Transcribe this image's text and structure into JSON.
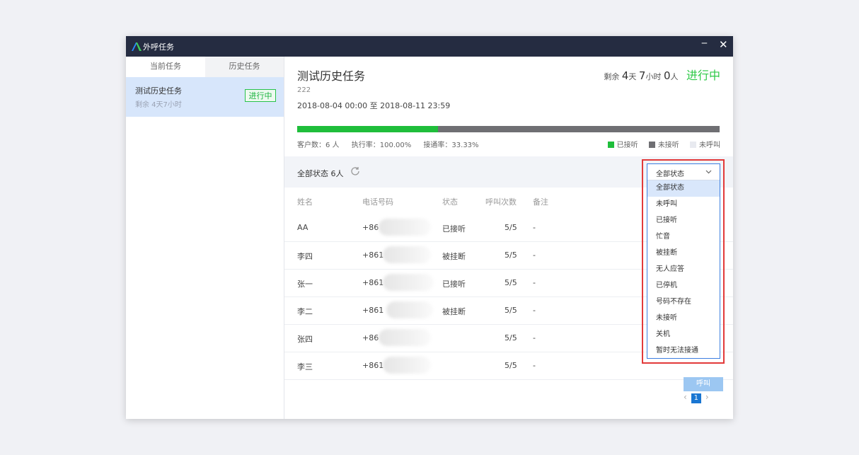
{
  "window": {
    "title": "外呼任务",
    "minimize": "‒",
    "close": "✕"
  },
  "sidebar": {
    "tabs": [
      {
        "label": "当前任务"
      },
      {
        "label": "历史任务"
      }
    ],
    "task": {
      "name": "测试历史任务",
      "remain": "剩余 4天7小时",
      "badge": "进行中"
    }
  },
  "main": {
    "title": "测试历史任务",
    "code": "222",
    "range": "2018-08-04 00:00 至 2018-08-11 23:59",
    "remain": {
      "prefix": "剩余",
      "days": "4",
      "days_unit": "天",
      "hours": "7",
      "hours_unit": "小时",
      "people": "0",
      "people_unit": "人",
      "status": "进行中"
    },
    "progress": {
      "answered_fraction": 0.333,
      "color_answered": "#1fbe3b",
      "color_unanswered": "#6f6f73"
    },
    "stats": {
      "customers": "客户数：6 人",
      "exec_rate": "执行率：100.00%",
      "connect_rate": "接通率：33.33%"
    },
    "legend": [
      {
        "label": "已接听",
        "color": "#1fbe3b"
      },
      {
        "label": "未接听",
        "color": "#6f6f73"
      },
      {
        "label": "未呼叫",
        "color": "#e8eaf0"
      }
    ],
    "filter": {
      "label": "全部状态 6人",
      "refresh_icon": "refresh-icon"
    },
    "table": {
      "headers": [
        "姓名",
        "电话号码",
        "状态",
        "呼叫次数",
        "备注"
      ],
      "rows": [
        {
          "name": "AA",
          "phone": "+86",
          "status": "已接听",
          "count": "5/5",
          "note": "-"
        },
        {
          "name": "李四",
          "phone": "+861",
          "status": "被挂断",
          "count": "5/5",
          "note": "-"
        },
        {
          "name": "张一",
          "phone": "+861",
          "status": "已接听",
          "count": "5/5",
          "note": "-"
        },
        {
          "name": "李二",
          "phone": "+861",
          "status": "被挂断",
          "count": "5/5",
          "note": "-"
        },
        {
          "name": "张四",
          "phone": "+86",
          "status": "",
          "count": "5/5",
          "note": "-"
        },
        {
          "name": "李三",
          "phone": "+861",
          "status": "",
          "count": "5/5",
          "note": "-"
        }
      ],
      "action_label": "呼叫"
    },
    "pager": {
      "prev": "‹",
      "page": "1",
      "next": "›"
    }
  },
  "dropdown": {
    "selected": "全部状态",
    "options": [
      "全部状态",
      "未呼叫",
      "已接听",
      "忙音",
      "被挂断",
      "无人应答",
      "已停机",
      "号码不存在",
      "未接听",
      "关机",
      "暂时无法接通"
    ]
  }
}
